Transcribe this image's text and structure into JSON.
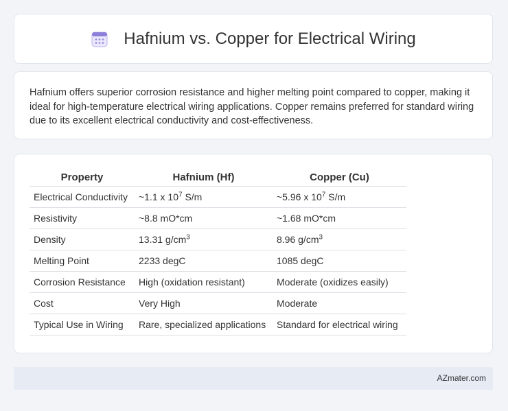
{
  "header": {
    "title": "Hafnium vs. Copper for Electrical Wiring",
    "icon": "calendar-icon",
    "icon_color": "#8b7fd8"
  },
  "intro": "Hafnium offers superior corrosion resistance and higher melting point compared to copper, making it ideal for high-temperature electrical wiring applications. Copper remains preferred for standard wiring due to its excellent electrical conductivity and cost-effectiveness.",
  "table": {
    "headers": [
      "Property",
      "Hafnium (Hf)",
      "Copper (Cu)"
    ],
    "rows": [
      {
        "property": "Electrical Conductivity",
        "hf": "~1.1 x 10",
        "hf_sup": "7",
        "hf_tail": " S/m",
        "cu": "~5.96 x 10",
        "cu_sup": "7",
        "cu_tail": " S/m"
      },
      {
        "property": "Resistivity",
        "hf": "~8.8 mO*cm",
        "cu": "~1.68 mO*cm"
      },
      {
        "property": "Density",
        "hf": "13.31 g/cm",
        "hf_sup": "3",
        "cu": "8.96 g/cm",
        "cu_sup": "3"
      },
      {
        "property": "Melting Point",
        "hf": "2233 degC",
        "cu": "1085 degC"
      },
      {
        "property": "Corrosion Resistance",
        "hf": "High (oxidation resistant)",
        "cu": "Moderate (oxidizes easily)"
      },
      {
        "property": "Cost",
        "hf": "Very High",
        "cu": "Moderate"
      },
      {
        "property": "Typical Use in Wiring",
        "hf": "Rare, specialized applications",
        "cu": "Standard for electrical wiring"
      }
    ]
  },
  "footer": {
    "brand": "AZmater.com"
  }
}
